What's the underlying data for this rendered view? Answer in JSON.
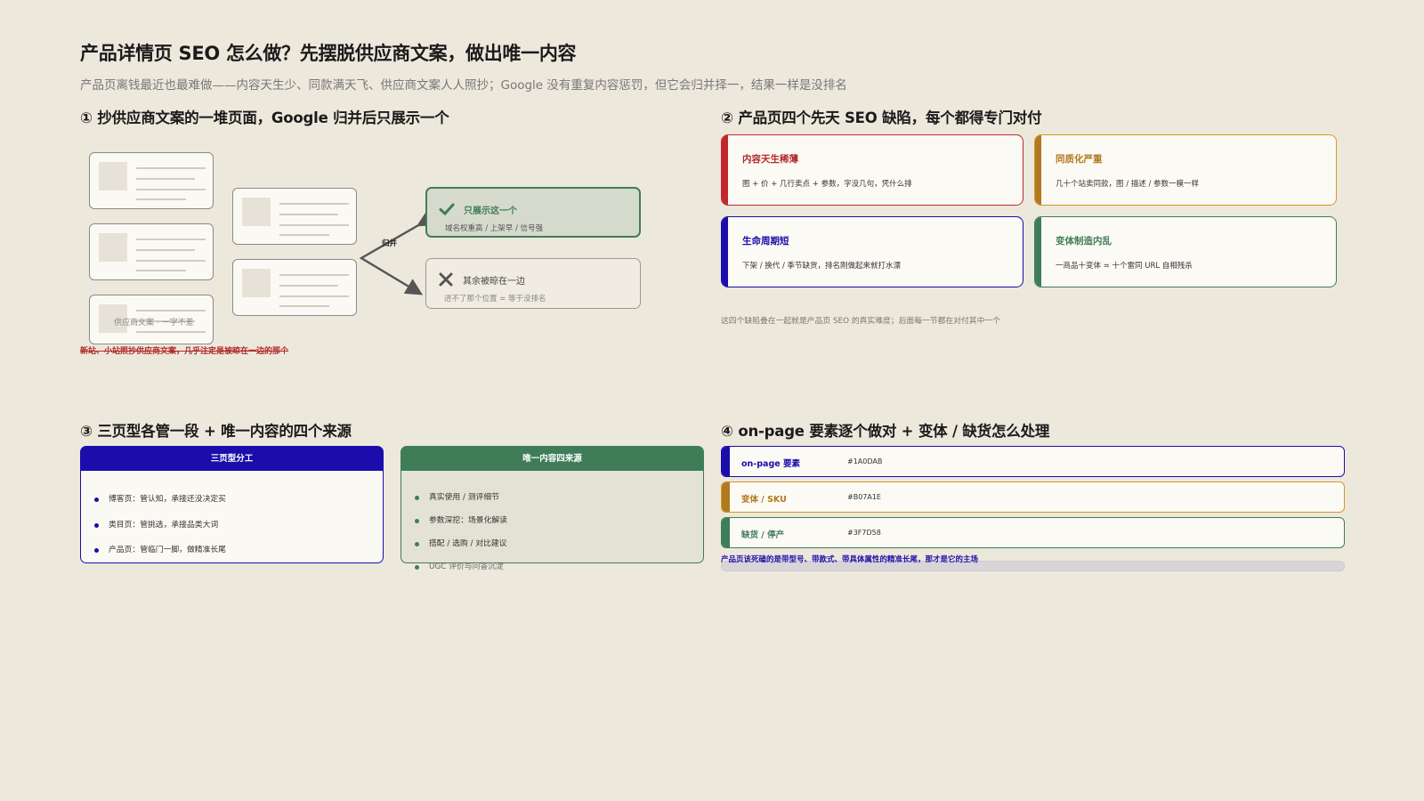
{
  "header": {
    "title": "产品详情页 SEO 怎么做？先摆脱供应商文案，做出唯一内容",
    "subtitle": "产品页离钱最近也最难做——内容天生少、同款满天飞、供应商文案人人照抄；Google 没有重复内容惩罚，但它会归并择一，结果一样是没排名"
  },
  "colors": {
    "blue": "#1A0DAB",
    "gold": "#B07A1E",
    "green": "#3F7D58",
    "red": "#C0282D"
  },
  "section1": {
    "title": "① 抄供应商文案的一堆页面，Google 归并后只展示一个",
    "doc_caption": "供应商文案 · 一字不差",
    "merge_label": "归并",
    "kept": {
      "title": "只展示这一个",
      "note": "域名权重高 / 上架早 / 信号强",
      "icon": "check-icon"
    },
    "folded": {
      "title": "其余被晾在一边",
      "note": "进不了那个位置 = 等于没排名",
      "icon": "cross-icon"
    },
    "note": "新站、小站照抄供应商文案，几乎注定是被晾在一边的那个"
  },
  "section2": {
    "title": "② 产品页四个先天 SEO 缺陷，每个都得专门对付",
    "cards": [
      {
        "title": "内容天生稀薄",
        "desc": "图 + 价 + 几行卖点 + 参数，字没几句，凭什么排"
      },
      {
        "title": "同质化严重",
        "desc": "几十个站卖同款，图 / 描述 / 参数一模一样"
      },
      {
        "title": "生命周期短",
        "desc": "下架 / 换代 / 季节缺货，排名刚做起来就打水漂"
      },
      {
        "title": "变体制造内乱",
        "desc": "一商品十变体 = 十个雷同 URL 自相残杀"
      }
    ],
    "note": "这四个缺陷叠在一起就是产品页 SEO 的真实难度；后面每一节都在对付其中一个"
  },
  "section3": {
    "title": "③ 三页型各管一段 + 唯一内容的四个来源",
    "panel_a": {
      "header": "三页型分工",
      "items": [
        "博客页：管认知，承接还没决定买",
        "类目页：管挑选，承接品类大词",
        "产品页：管临门一脚，做精准长尾"
      ]
    },
    "panel_b": {
      "header": "唯一内容四来源",
      "items": [
        "真实使用 / 测评细节",
        "参数深挖：场景化解读",
        "搭配 / 选购 / 对比建议",
        "UGC 评价与问答沉淀"
      ]
    }
  },
  "section4": {
    "title": "④ on-page 要素逐个做对 + 变体 / 缺货怎么处理",
    "rows": [
      {
        "label": "on-page 要素",
        "value": "#1A0DAB"
      },
      {
        "label": "变体 / SKU",
        "value": "#B07A1E"
      },
      {
        "label": "缺货 / 停产",
        "value": "#3F7D58"
      }
    ],
    "note": "产品页该死磕的是带型号、带款式、带具体属性的精准长尾，那才是它的主场"
  }
}
